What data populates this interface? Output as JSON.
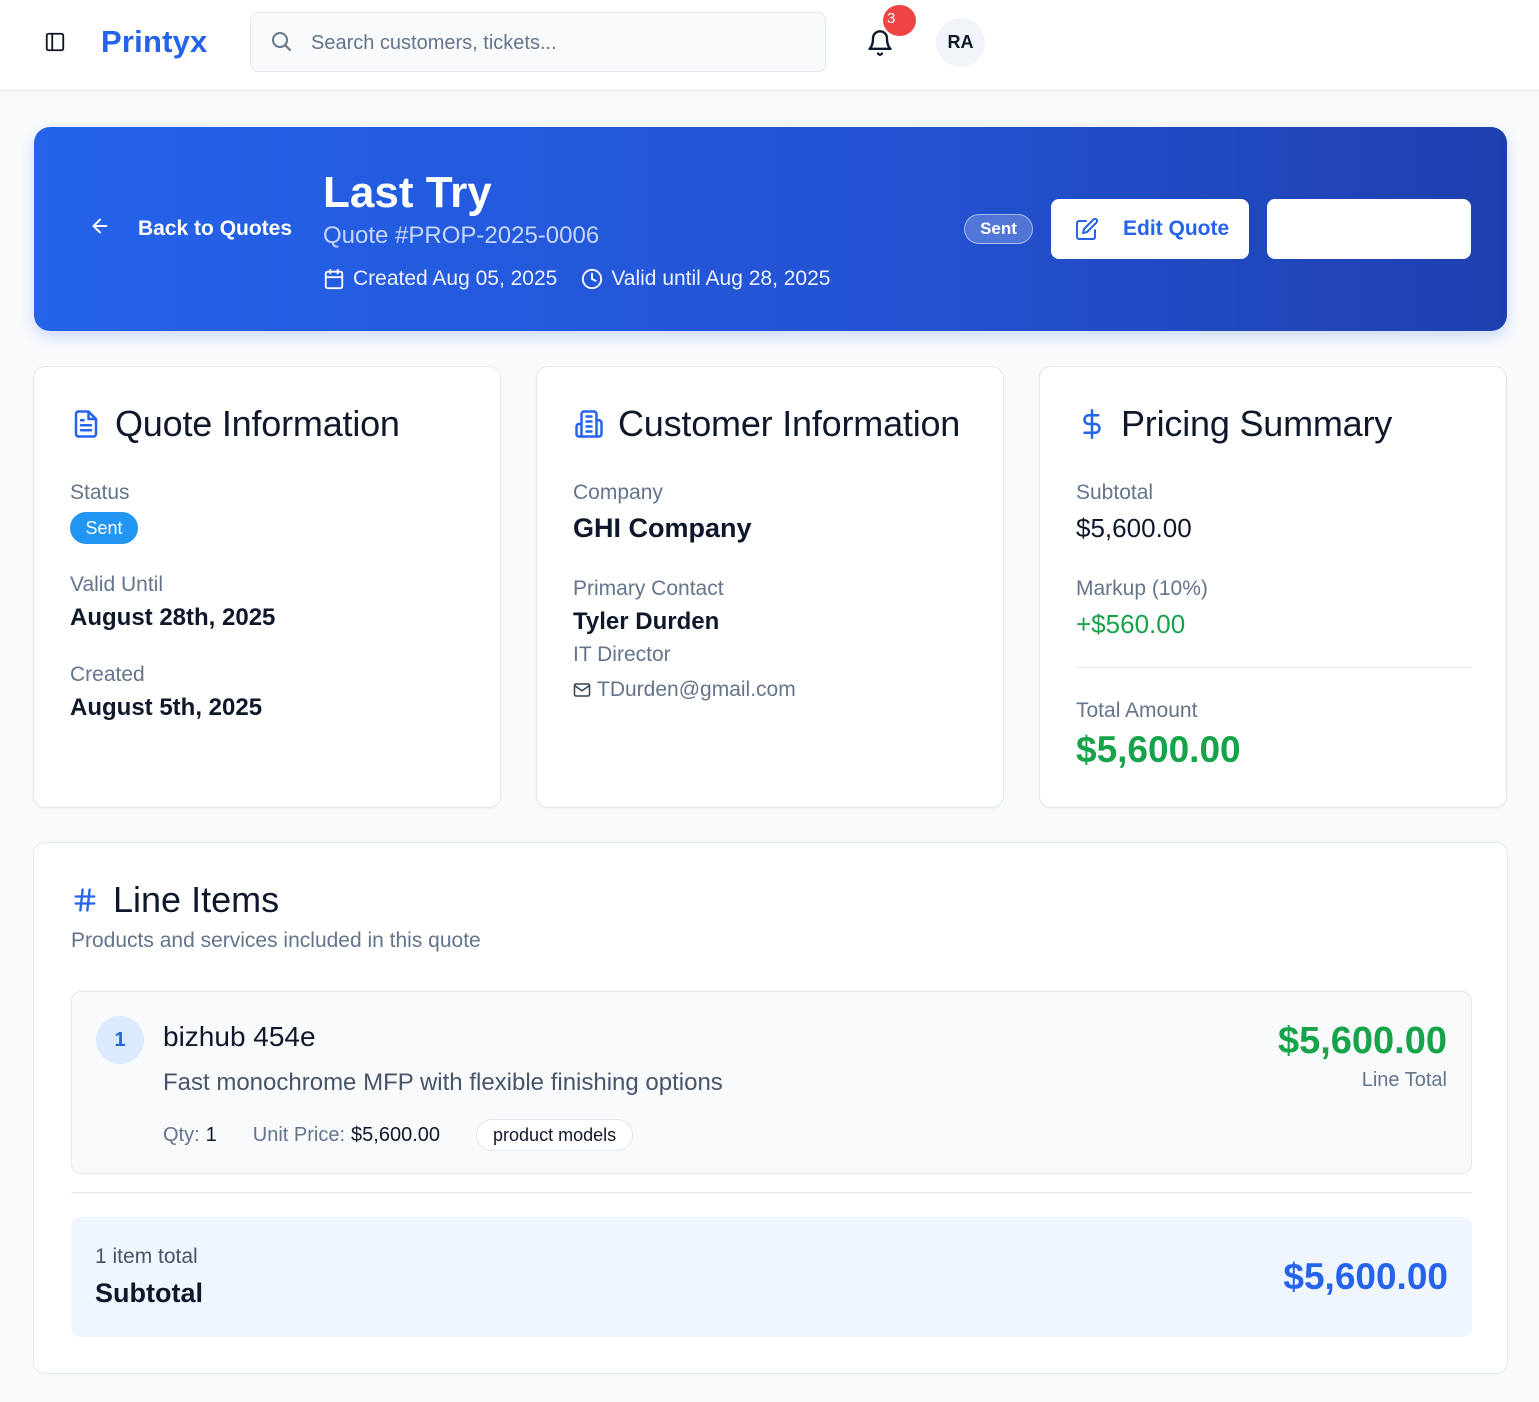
{
  "topbar": {
    "brand": "Printyx",
    "search_placeholder": "Search customers, tickets...",
    "notification_count": "3",
    "avatar_initials": "RA"
  },
  "hero": {
    "back_label": "Back to Quotes",
    "title": "Last Try",
    "quote_number": "Quote #PROP-2025-0006",
    "created": "Created Aug 05, 2025",
    "valid_until": "Valid until Aug 28, 2025",
    "status_badge": "Sent",
    "edit_label": "Edit Quote"
  },
  "quote_info": {
    "title": "Quote Information",
    "status_label": "Status",
    "status_value": "Sent",
    "valid_until_label": "Valid Until",
    "valid_until_value": "August 28th, 2025",
    "created_label": "Created",
    "created_value": "August 5th, 2025"
  },
  "customer_info": {
    "title": "Customer Information",
    "company_label": "Company",
    "company_value": "GHI Company",
    "contact_label": "Primary Contact",
    "contact_name": "Tyler Durden",
    "contact_role": "IT Director",
    "contact_email": "TDurden@gmail.com"
  },
  "pricing": {
    "title": "Pricing Summary",
    "subtotal_label": "Subtotal",
    "subtotal_value": "$5,600.00",
    "markup_label": "Markup (10%)",
    "markup_value": "+$560.00",
    "total_label": "Total Amount",
    "total_value": "$5,600.00"
  },
  "line_items": {
    "title": "Line Items",
    "subtitle": "Products and services included in this quote",
    "items": [
      {
        "index": "1",
        "name": "bizhub 454e",
        "description": "Fast monochrome MFP with flexible finishing options",
        "qty_label": "Qty:",
        "qty_value": "1",
        "unit_price_label": "Unit Price:",
        "unit_price_value": "$5,600.00",
        "tag": "product models",
        "line_total": "$5,600.00",
        "line_total_label": "Line Total"
      }
    ],
    "summary_count": "1 item total",
    "summary_label": "Subtotal",
    "summary_value": "$5,600.00"
  },
  "colors": {
    "brand": "#2563eb",
    "success": "#16a34a",
    "status_sent": "#2196f3"
  }
}
